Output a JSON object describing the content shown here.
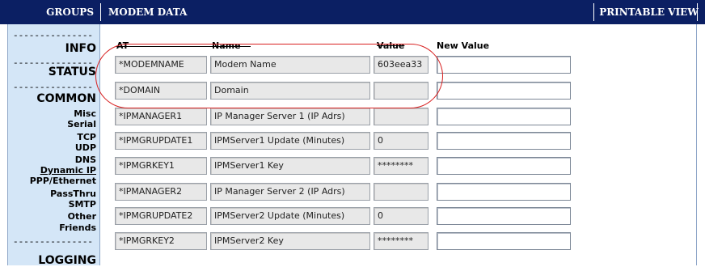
{
  "header": {
    "groups_label": "GROUPS",
    "modem_data_label": "MODEM DATA",
    "printable_view_label": "PRINTABLE VIEW"
  },
  "sidebar": {
    "dashes": "---------------",
    "sections": [
      {
        "label": "INFO"
      },
      {
        "label": "STATUS"
      },
      {
        "label": "COMMON"
      },
      {
        "label": "LOGGING"
      }
    ],
    "common_items": [
      {
        "label": "Misc",
        "link": false
      },
      {
        "label": "Serial",
        "link": false
      },
      {
        "label": "TCP",
        "link": false
      },
      {
        "label": "UDP",
        "link": false
      },
      {
        "label": "DNS",
        "link": false
      },
      {
        "label": "Dynamic IP",
        "link": true
      },
      {
        "label": "PPP/Ethernet",
        "link": false
      },
      {
        "label": "PassThru",
        "link": false
      },
      {
        "label": "SMTP",
        "link": false
      },
      {
        "label": "Other",
        "link": false
      },
      {
        "label": "Friends",
        "link": false
      }
    ]
  },
  "table": {
    "columns": {
      "at": "AT",
      "name": "Name",
      "value": "Value",
      "new_value": "New Value"
    },
    "rows": [
      {
        "at": "*MODEMNAME",
        "name": "Modem Name",
        "value": "603eea33",
        "new_value": ""
      },
      {
        "at": "*DOMAIN",
        "name": "Domain",
        "value": "",
        "new_value": ""
      },
      {
        "at": "*IPMANAGER1",
        "name": "IP Manager Server 1 (IP Adrs)",
        "value": "",
        "new_value": ""
      },
      {
        "at": "*IPMGRUPDATE1",
        "name": "IPMServer1 Update (Minutes)",
        "value": "0",
        "new_value": ""
      },
      {
        "at": "*IPMGRKEY1",
        "name": "IPMServer1 Key",
        "value": "********",
        "new_value": ""
      },
      {
        "at": "*IPMANAGER2",
        "name": "IP Manager Server 2 (IP Adrs)",
        "value": "",
        "new_value": ""
      },
      {
        "at": "*IPMGRUPDATE2",
        "name": "IPMServer2 Update (Minutes)",
        "value": "0",
        "new_value": ""
      },
      {
        "at": "*IPMGRKEY2",
        "name": "IPMServer2 Key",
        "value": "********",
        "new_value": ""
      }
    ]
  },
  "colors": {
    "header_bg": "#0b1f63",
    "sidebar_bg": "#d4e6f7",
    "highlight_oval": "#d82020"
  }
}
